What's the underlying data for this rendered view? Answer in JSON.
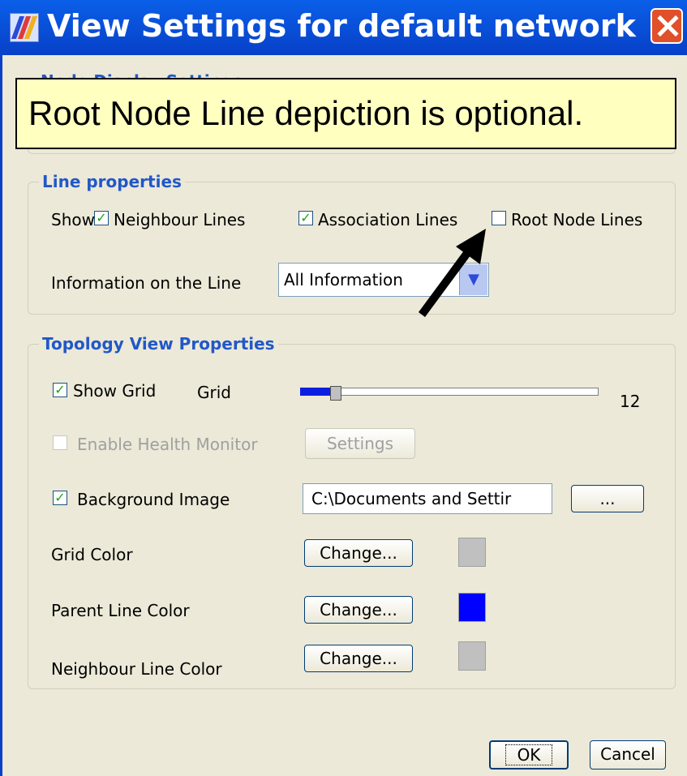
{
  "window": {
    "title": "View Settings for default network"
  },
  "tooltip": "Root Node Line depiction is optional.",
  "node_display": {
    "legend": "Node Display Settings"
  },
  "line_properties": {
    "legend": "Line properties",
    "show_label": "Show",
    "neighbour": {
      "label": "Neighbour Lines",
      "checked": true
    },
    "association": {
      "label": "Association Lines",
      "checked": true
    },
    "root_node": {
      "label": "Root Node Lines",
      "checked": false
    },
    "info_label": "Information on the Line",
    "info_value": "All Information"
  },
  "topology": {
    "legend": "Topology View Properties",
    "show_grid": {
      "label": "Show Grid",
      "checked": true
    },
    "grid_label": "Grid",
    "grid_value": "12",
    "grid_fraction": 0.12,
    "health_monitor": {
      "label": "Enable Health Monitor",
      "checked": false,
      "enabled": false
    },
    "settings_button": "Settings",
    "background_image": {
      "label": "Background Image",
      "checked": true,
      "path": "C:\\Documents and Settir",
      "browse_label": "..."
    },
    "grid_color": {
      "label": "Grid Color",
      "button": "Change...",
      "color": "#c0c0c0"
    },
    "parent_line_color": {
      "label": "Parent Line Color",
      "button": "Change...",
      "color": "#0000ff"
    },
    "neighbour_line_color": {
      "label": "Neighbour Line Color",
      "button": "Change...",
      "color": "#c0c0c0"
    }
  },
  "footer": {
    "ok": "OK",
    "cancel": "Cancel"
  },
  "icons": {
    "checkmark": "check-icon",
    "close": "close-icon",
    "dropdown": "chevron-down-icon",
    "arrow": "pointer-arrow-icon"
  }
}
